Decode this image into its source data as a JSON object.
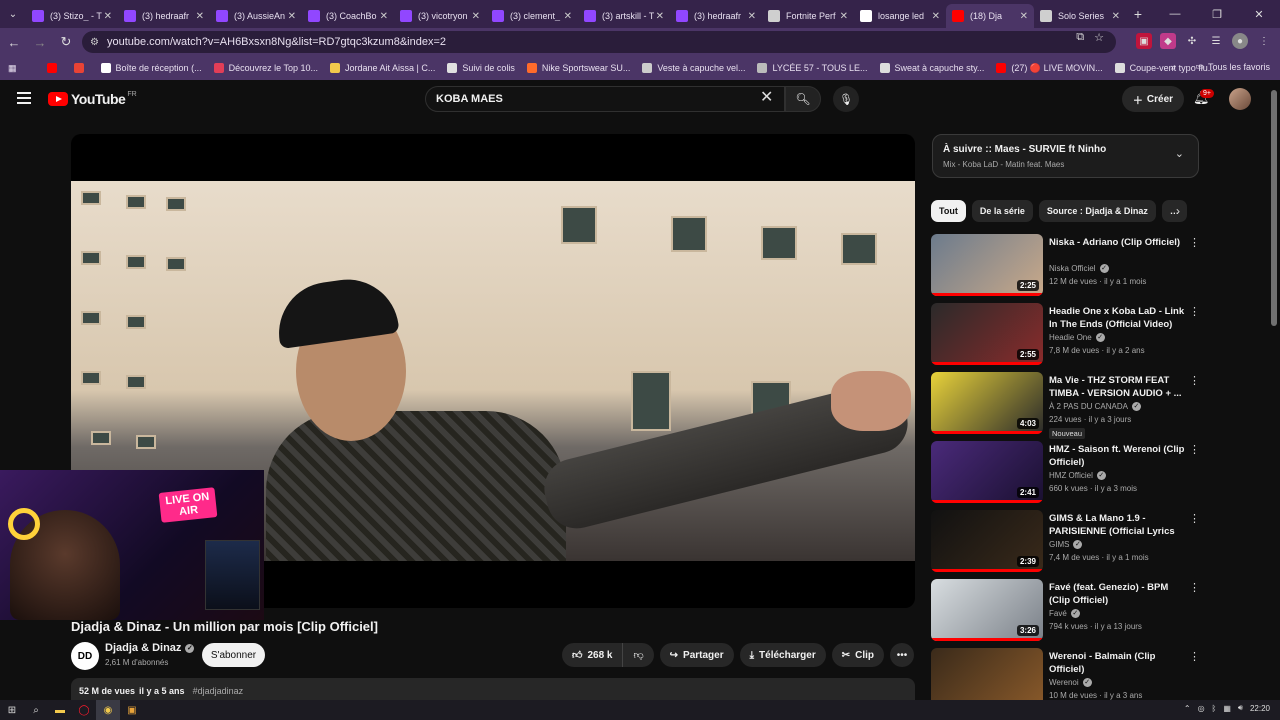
{
  "browser": {
    "tabs": [
      {
        "title": "(3) Stizo_ - T",
        "icon": "twitch-icon",
        "color": "#9147ff"
      },
      {
        "title": "(3) hedraafr",
        "icon": "twitch-icon",
        "color": "#9147ff"
      },
      {
        "title": "(3) AussieAn",
        "icon": "twitch-icon",
        "color": "#9147ff"
      },
      {
        "title": "(3) CoachBo",
        "icon": "twitch-icon",
        "color": "#9147ff"
      },
      {
        "title": "(3) vicotryon",
        "icon": "twitch-icon",
        "color": "#9147ff"
      },
      {
        "title": "(3) clement_",
        "icon": "twitch-icon",
        "color": "#9147ff"
      },
      {
        "title": "(3) artskill - T",
        "icon": "twitch-icon",
        "color": "#9147ff"
      },
      {
        "title": "(3) hedraafr",
        "icon": "twitch-icon",
        "color": "#9147ff"
      },
      {
        "title": "Fortnite Perf",
        "icon": "page-icon",
        "color": "#cfcfcf"
      },
      {
        "title": "losange led",
        "icon": "google-icon",
        "color": "#ffffff"
      },
      {
        "title": "(18) Dja",
        "icon": "youtube-icon",
        "color": "#ff0000"
      },
      {
        "title": "Solo Series",
        "icon": "page-icon",
        "color": "#cfcfcf"
      }
    ],
    "url": "youtube.com/watch?v=AH6Bxsxn8Ng&list=RD7gtqc3kzum8&index=2",
    "bookmarks": [
      {
        "label": "",
        "color": "#ff0000"
      },
      {
        "label": "",
        "color": "#ea4335"
      },
      {
        "label": "Boîte de réception (...",
        "color": "#ffffff"
      },
      {
        "label": "Découvrez le Top 10...",
        "color": "#e23e57"
      },
      {
        "label": "Jordane Ait Aissa | C...",
        "color": "#f2c94c"
      },
      {
        "label": "Suivi de colis",
        "color": "#e0e0e0"
      },
      {
        "label": "Nike Sportswear SU...",
        "color": "#ff6b2b"
      },
      {
        "label": "Veste à capuche vel...",
        "color": "#cccccc"
      },
      {
        "label": "LYCÉE 57 - TOUS LE...",
        "color": "#bbbbbb"
      },
      {
        "label": "Sweat à capuche sty...",
        "color": "#dddddd"
      },
      {
        "label": "(27) 🔴 LIVE MOVIN...",
        "color": "#ff0000"
      },
      {
        "label": "Coupe-vent typo flu...",
        "color": "#dddddd"
      }
    ],
    "all_bookmarks": "Tous les favoris"
  },
  "youtube": {
    "logo_text": "YouTube",
    "country": "FR",
    "search_value": "KOBA MAES",
    "create_label": "Créer",
    "notif_count": "9+"
  },
  "video": {
    "title": "Djadja & Dinaz - Un million par mois [Clip Officiel]",
    "channel": "Djadja & Dinaz",
    "channel_initials": "DD",
    "subscribers": "2,61 M d'abonnés",
    "subscribe_label": "S'abonner",
    "likes": "268 k",
    "share_label": "Partager",
    "download_label": "Télécharger",
    "clip_label": "Clip",
    "views": "52 M de vues",
    "age": "il y a 5 ans",
    "hashtag": "#djadjadinaz"
  },
  "webcam": {
    "overlay_text": "LIVE ON AIR"
  },
  "playlist": {
    "title": "À suivre :: Maes - SURVIE ft Ninho",
    "subtitle": "Mix - Koba LaD - Matin feat. Maes"
  },
  "chips": [
    "Tout",
    "De la série",
    "Source : Djadja & Dinaz",
    "…"
  ],
  "recommendations": [
    {
      "title": "Niska - Adriano (Clip Officiel)",
      "channel": "Niska Officiel",
      "meta": "12 M de vues · il y a 1 mois",
      "duration": "2:25",
      "badge": "",
      "c1": "#6c7b8c",
      "c2": "#c9a98a"
    },
    {
      "title": "Headie One x Koba LaD - Link In The Ends (Official Video)",
      "channel": "Headie One",
      "meta": "7,8 M de vues · il y a 2 ans",
      "duration": "2:55",
      "badge": "",
      "c1": "#2b2a2a",
      "c2": "#8a2b2b"
    },
    {
      "title": "Ma Vie - THZ STORM FEAT TIMBA - VERSION AUDIO + ...",
      "channel": "À 2 PAS DU CANADA",
      "meta": "224 vues · il y a 3 jours",
      "duration": "4:03",
      "badge": "Nouveau",
      "c1": "#e8d23a",
      "c2": "#2a2a2a"
    },
    {
      "title": "HMZ - Saison ft. Werenoi (Clip Officiel)",
      "channel": "HMZ Officiel",
      "meta": "660 k vues · il y a 3 mois",
      "duration": "2:41",
      "badge": "",
      "c1": "#4a2a7a",
      "c2": "#1a1030"
    },
    {
      "title": "GIMS & La Mano 1.9 - PARISIENNE (Official Lyrics ...",
      "channel": "GIMS",
      "meta": "7,4 M de vues · il y a 1 mois",
      "duration": "2:39",
      "badge": "",
      "c1": "#111111",
      "c2": "#3a2a1a"
    },
    {
      "title": "Favé (feat. Genezio) - BPM (Clip Officiel)",
      "channel": "Favé",
      "meta": "794 k vues · il y a 13 jours",
      "duration": "3:26",
      "badge": "",
      "c1": "#d8dde0",
      "c2": "#7a8088"
    },
    {
      "title": "Werenoi - Balmain (Clip Officiel)",
      "channel": "Werenoi",
      "meta": "10 M de vues · il y a 3 ans",
      "duration": "",
      "badge": "",
      "c1": "#3a2a1a",
      "c2": "#8a5a2a"
    }
  ],
  "taskbar": {
    "time": "22:20"
  }
}
